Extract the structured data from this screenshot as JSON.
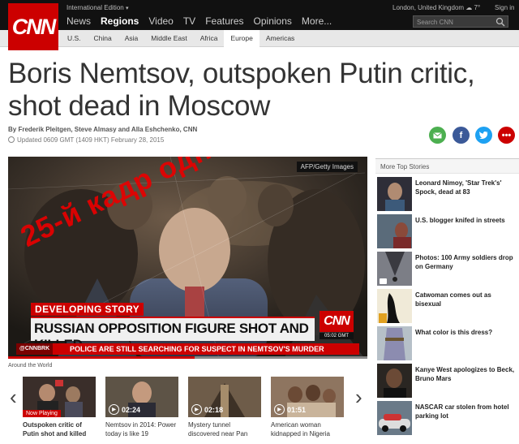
{
  "header": {
    "logo_text": "CNN",
    "edition": "International Edition",
    "nav": [
      "News",
      "Regions",
      "Video",
      "TV",
      "Features",
      "Opinions",
      "More..."
    ],
    "nav_active": "Regions",
    "location": "London, United Kingdom",
    "temperature": "7°",
    "signin": "Sign in",
    "search_placeholder": "Search CNN"
  },
  "subnav": {
    "items": [
      "U.S.",
      "China",
      "Asia",
      "Middle East",
      "Africa",
      "Europe",
      "Americas"
    ],
    "active": "Europe"
  },
  "article": {
    "headline": "Boris Nemtsov, outspoken Putin critic, shot dead in Moscow",
    "byline": "By Frederik Pleitgen, Steve Almasy and Alla Eshchenko, CNN",
    "updated": "Updated 0609 GMT (1409 HKT) February 28, 2015"
  },
  "share": {
    "mail_icon": "mail-icon",
    "facebook_icon": "facebook-icon",
    "twitter_icon": "twitter-icon",
    "more_icon": "more-icon"
  },
  "video": {
    "credit": "AFP/Getty Images",
    "overlay_text": "25-й кадр однако",
    "developing_story": "DEVELOPING STORY",
    "lower_third": "RUSSIAN OPPOSITION FIGURE SHOT AND KILLED",
    "bug_logo": "CNN",
    "bug_time": "05:02 GMT",
    "ticker_tag": "@CNNBRK",
    "ticker_msg": "POLICE ARE STILL SEARCHING FOR SUSPECT IN NEMTSOV'S MURDER",
    "progress": 0.52
  },
  "around": {
    "label": "Around the World",
    "cards": [
      {
        "badge": "Now Playing",
        "caption": "Outspoken critic of Putin shot and killed",
        "duration": ""
      },
      {
        "badge": "",
        "caption": "Nemtsov in 2014: Power today is like 19",
        "duration": "02:24"
      },
      {
        "badge": "",
        "caption": "Mystery tunnel discovered near Pan",
        "duration": "02:18"
      },
      {
        "badge": "",
        "caption": "American woman kidnapped in Nigeria",
        "duration": "01:51"
      }
    ]
  },
  "sidebar": {
    "title": "More Top Stories",
    "stories": [
      "Leonard Nimoy, 'Star Trek's' Spock, dead at 83",
      "U.S. blogger knifed in streets",
      "Photos: 100 Army soldiers drop on Germany",
      "Catwoman comes out as bisexual",
      "What color is this dress?",
      "Kanye West apologizes to Beck, Bruno Mars",
      "NASCAR car stolen from hotel parking lot"
    ]
  }
}
